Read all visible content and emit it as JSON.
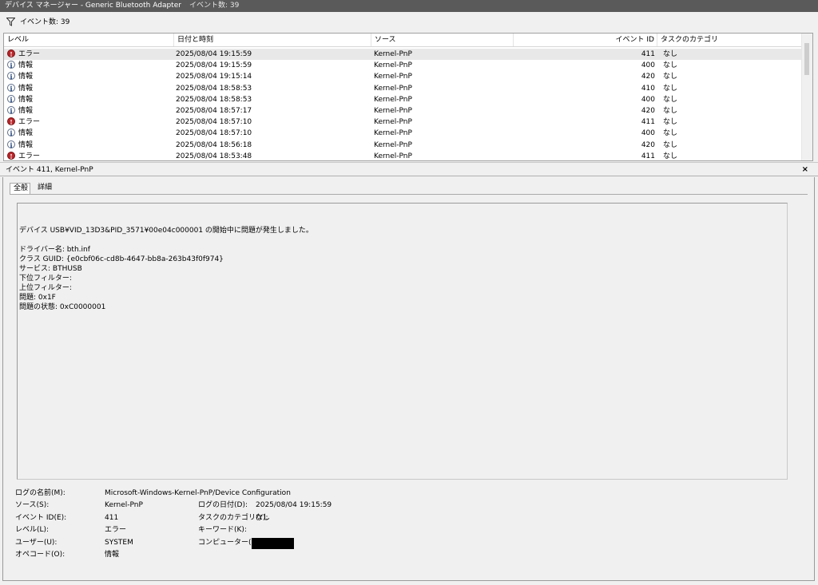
{
  "window": {
    "title": "デバイス マネージャー - Generic Bluetooth Adapter",
    "event_count": "イベント数: 39"
  },
  "filter": {
    "label": "イベント数: 39"
  },
  "grid": {
    "columns": [
      "レベル",
      "日付と時刻",
      "ソース",
      "イベント ID",
      "タスクのカテゴリ"
    ],
    "rows": [
      {
        "level": "エラー",
        "type": "error",
        "date": "2025/08/04 19:15:59",
        "source": "Kernel-PnP",
        "id": "411",
        "category": "なし"
      },
      {
        "level": "情報",
        "type": "info",
        "date": "2025/08/04 19:15:59",
        "source": "Kernel-PnP",
        "id": "400",
        "category": "なし"
      },
      {
        "level": "情報",
        "type": "info",
        "date": "2025/08/04 19:15:14",
        "source": "Kernel-PnP",
        "id": "420",
        "category": "なし"
      },
      {
        "level": "情報",
        "type": "info",
        "date": "2025/08/04 18:58:53",
        "source": "Kernel-PnP",
        "id": "410",
        "category": "なし"
      },
      {
        "level": "情報",
        "type": "info",
        "date": "2025/08/04 18:58:53",
        "source": "Kernel-PnP",
        "id": "400",
        "category": "なし"
      },
      {
        "level": "情報",
        "type": "info",
        "date": "2025/08/04 18:57:17",
        "source": "Kernel-PnP",
        "id": "420",
        "category": "なし"
      },
      {
        "level": "エラー",
        "type": "error",
        "date": "2025/08/04 18:57:10",
        "source": "Kernel-PnP",
        "id": "411",
        "category": "なし"
      },
      {
        "level": "情報",
        "type": "info",
        "date": "2025/08/04 18:57:10",
        "source": "Kernel-PnP",
        "id": "400",
        "category": "なし"
      },
      {
        "level": "情報",
        "type": "info",
        "date": "2025/08/04 18:56:18",
        "source": "Kernel-PnP",
        "id": "420",
        "category": "なし"
      },
      {
        "level": "エラー",
        "type": "error",
        "date": "2025/08/04 18:53:48",
        "source": "Kernel-PnP",
        "id": "411",
        "category": "なし"
      }
    ]
  },
  "detail": {
    "title": "イベント 411, Kernel-PnP",
    "close": "×",
    "tabs": [
      "全般",
      "詳細"
    ],
    "description_lines": [
      "デバイス USB¥VID_13D3&PID_3571¥00e04c000001 の開始中に問題が発生しました。",
      "",
      "ドライバー名: bth.inf",
      "クラス GUID: {e0cbf06c-cd8b-4647-bb8a-263b43f0f974}",
      "サービス: BTHUSB",
      "下位フィルター:",
      "上位フィルター:",
      "問題: 0x1F",
      "問題の状態: 0xC0000001"
    ],
    "properties": {
      "log_name_label": "ログの名前(M):",
      "log_name": "Microsoft-Windows-Kernel-PnP/Device Configuration",
      "source_label": "ソース(S):",
      "source": "Kernel-PnP",
      "logged_label": "ログの日付(D):",
      "logged": "2025/08/04 19:15:59",
      "event_id_label": "イベント ID(E):",
      "event_id": "411",
      "task_label": "タスクのカテゴリ(Y):",
      "task": "なし",
      "level_label": "レベル(L):",
      "level": "エラー",
      "keywords_label": "キーワード(K):",
      "user_label": "ユーザー(U):",
      "user": "SYSTEM",
      "computer_label": "コンピューター(R):",
      "opcode_label": "オペコード(O):",
      "opcode": "情報"
    }
  }
}
